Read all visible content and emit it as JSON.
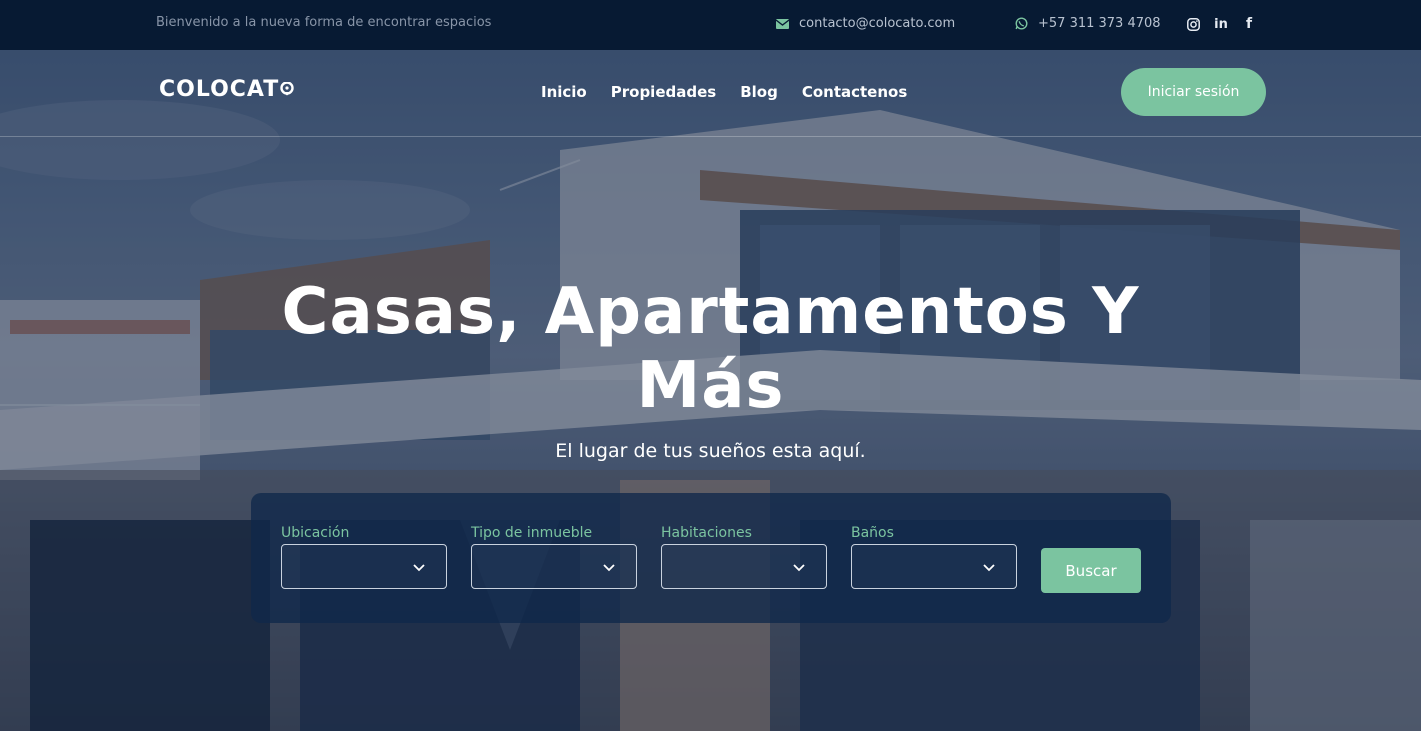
{
  "topbar": {
    "welcome": "Bienvenido a la nueva forma de encontrar espacios",
    "email": "contacto@colocato.com",
    "phone": "+57 311 373 4708",
    "social": [
      "instagram-icon",
      "linkedin-icon",
      "facebook-icon"
    ]
  },
  "nav": {
    "logo": "COLOCAT",
    "menu": [
      "Inicio",
      "Propiedades",
      "Blog",
      "Contactenos"
    ],
    "login": "Iniciar sesión"
  },
  "hero": {
    "title_line1": "Casas, Apartamentos Y",
    "title_line2": "Más",
    "subtitle": "El lugar de tus sueños esta aquí."
  },
  "search": {
    "fields": [
      {
        "label": "Ubicación",
        "value": ""
      },
      {
        "label": "Tipo de inmueble",
        "value": ""
      },
      {
        "label": "Habitaciones",
        "value": ""
      },
      {
        "label": "Baños",
        "value": ""
      }
    ],
    "button": "Buscar"
  },
  "colors": {
    "accent": "#7bc4a0",
    "topbar": "#071a33",
    "overlay": "#0e203e"
  }
}
